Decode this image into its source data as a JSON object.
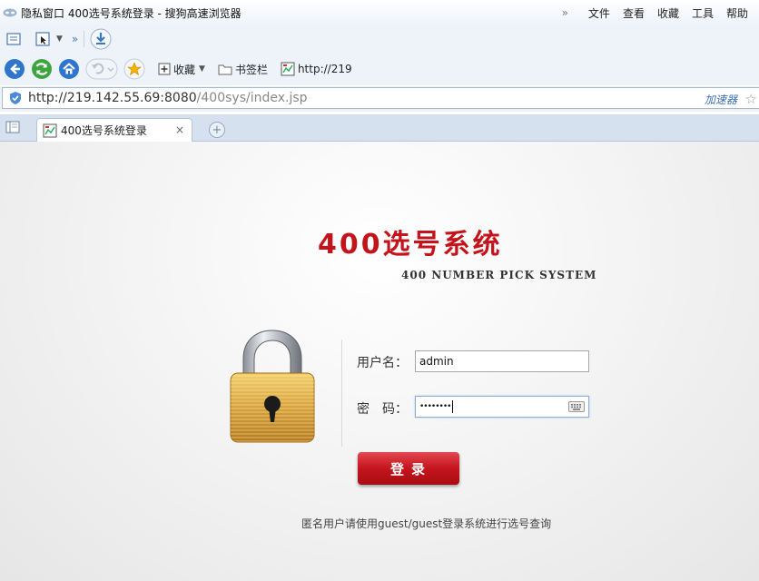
{
  "window": {
    "title": "隐私窗口 400选号系统登录 - 搜狗高速浏览器",
    "menu": [
      "文件",
      "查看",
      "收藏",
      "工具",
      "帮助"
    ]
  },
  "toolbar": {
    "favorites_label": "收藏",
    "bookmarks_bar_label": "书签栏",
    "shortcut_label": "http://219"
  },
  "address": {
    "url_main": "http://219.142.55.69:8080",
    "url_path": "/400sys/index.jsp",
    "accelerator_label": "加速器"
  },
  "tab": {
    "title": "400选号系统登录",
    "close": "×",
    "new_tab": "+"
  },
  "login": {
    "brand_title": "400选号系统",
    "brand_subtitle": "400 NUMBER PICK SYSTEM",
    "username_label": "用户名：",
    "username_value": "admin",
    "password_label": "密　码：",
    "password_value": "••••••••",
    "submit_label": "登录",
    "hint": "匿名用户请使用guest/guest登录系统进行选号查询"
  },
  "colors": {
    "brand_red": "#c4141b",
    "chrome_blue": "#eef3fa",
    "accent_blue": "#3a6db5"
  }
}
